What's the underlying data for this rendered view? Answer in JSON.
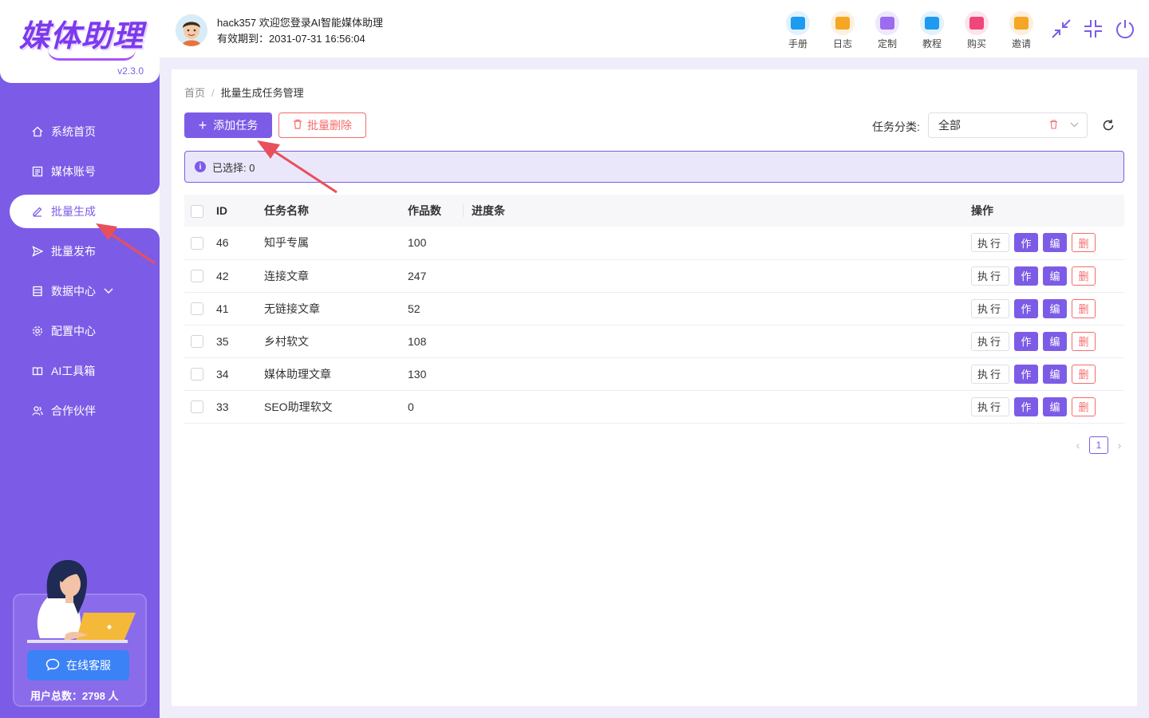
{
  "app": {
    "logo_text": "媒体助理",
    "version": "v2.3.0"
  },
  "header": {
    "welcome": "hack357 欢迎您登录AI智能媒体助理",
    "expire": "有效期到：2031-07-31 16:56:04",
    "tools": [
      {
        "label": "手册",
        "icon": "manual-icon",
        "color": "#1e9bf0",
        "bg": "#e1f1fd"
      },
      {
        "label": "日志",
        "icon": "log-icon",
        "color": "#f5a623",
        "bg": "#fdf1de"
      },
      {
        "label": "定制",
        "icon": "custom-icon",
        "color": "#9b6cf0",
        "bg": "#efe7fd"
      },
      {
        "label": "教程",
        "icon": "tutorial-icon",
        "color": "#1e9bf0",
        "bg": "#e1f1fd"
      },
      {
        "label": "购买",
        "icon": "buy-icon",
        "color": "#f0477a",
        "bg": "#fde4ec"
      },
      {
        "label": "邀请",
        "icon": "invite-icon",
        "color": "#f5a623",
        "bg": "#fdeedd"
      }
    ]
  },
  "sidebar": {
    "items": [
      {
        "label": "系统首页",
        "icon": "home-icon"
      },
      {
        "label": "媒体账号",
        "icon": "account-icon"
      },
      {
        "label": "批量生成",
        "icon": "edit-icon",
        "active": true
      },
      {
        "label": "批量发布",
        "icon": "send-icon"
      },
      {
        "label": "数据中心",
        "icon": "data-icon",
        "has_submenu": true
      },
      {
        "label": "配置中心",
        "icon": "gear-icon"
      },
      {
        "label": "AI工具箱",
        "icon": "toolbox-icon"
      },
      {
        "label": "合作伙伴",
        "icon": "partner-icon"
      }
    ],
    "support_button": "在线客服",
    "user_total": "用户总数：2798 人"
  },
  "breadcrumb": {
    "home": "首页",
    "separator": "/",
    "current": "批量生成任务管理"
  },
  "toolbar": {
    "add_label": "添加任务",
    "batch_delete_label": "批量删除",
    "category_label": "任务分类:",
    "category_value": "全部"
  },
  "alert": {
    "selected_text": "已选择: 0"
  },
  "table": {
    "headers": [
      "ID",
      "任务名称",
      "作品数",
      "进度条",
      "操作"
    ],
    "ops": {
      "run": "执行",
      "work": "作",
      "edit": "编",
      "delete": "删"
    },
    "rows": [
      {
        "id": "46",
        "name": "知乎专属",
        "count": "100"
      },
      {
        "id": "42",
        "name": "连接文章",
        "count": "247"
      },
      {
        "id": "41",
        "name": "无链接文章",
        "count": "52"
      },
      {
        "id": "35",
        "name": "乡村软文",
        "count": "108"
      },
      {
        "id": "34",
        "name": "媒体助理文章",
        "count": "130"
      },
      {
        "id": "33",
        "name": "SEO助理软文",
        "count": "0"
      }
    ]
  },
  "pagination": {
    "current_page": "1"
  },
  "colors": {
    "primary": "#7c5ce6",
    "danger": "#f56c6c",
    "annotation_arrow": "#e8505b"
  }
}
